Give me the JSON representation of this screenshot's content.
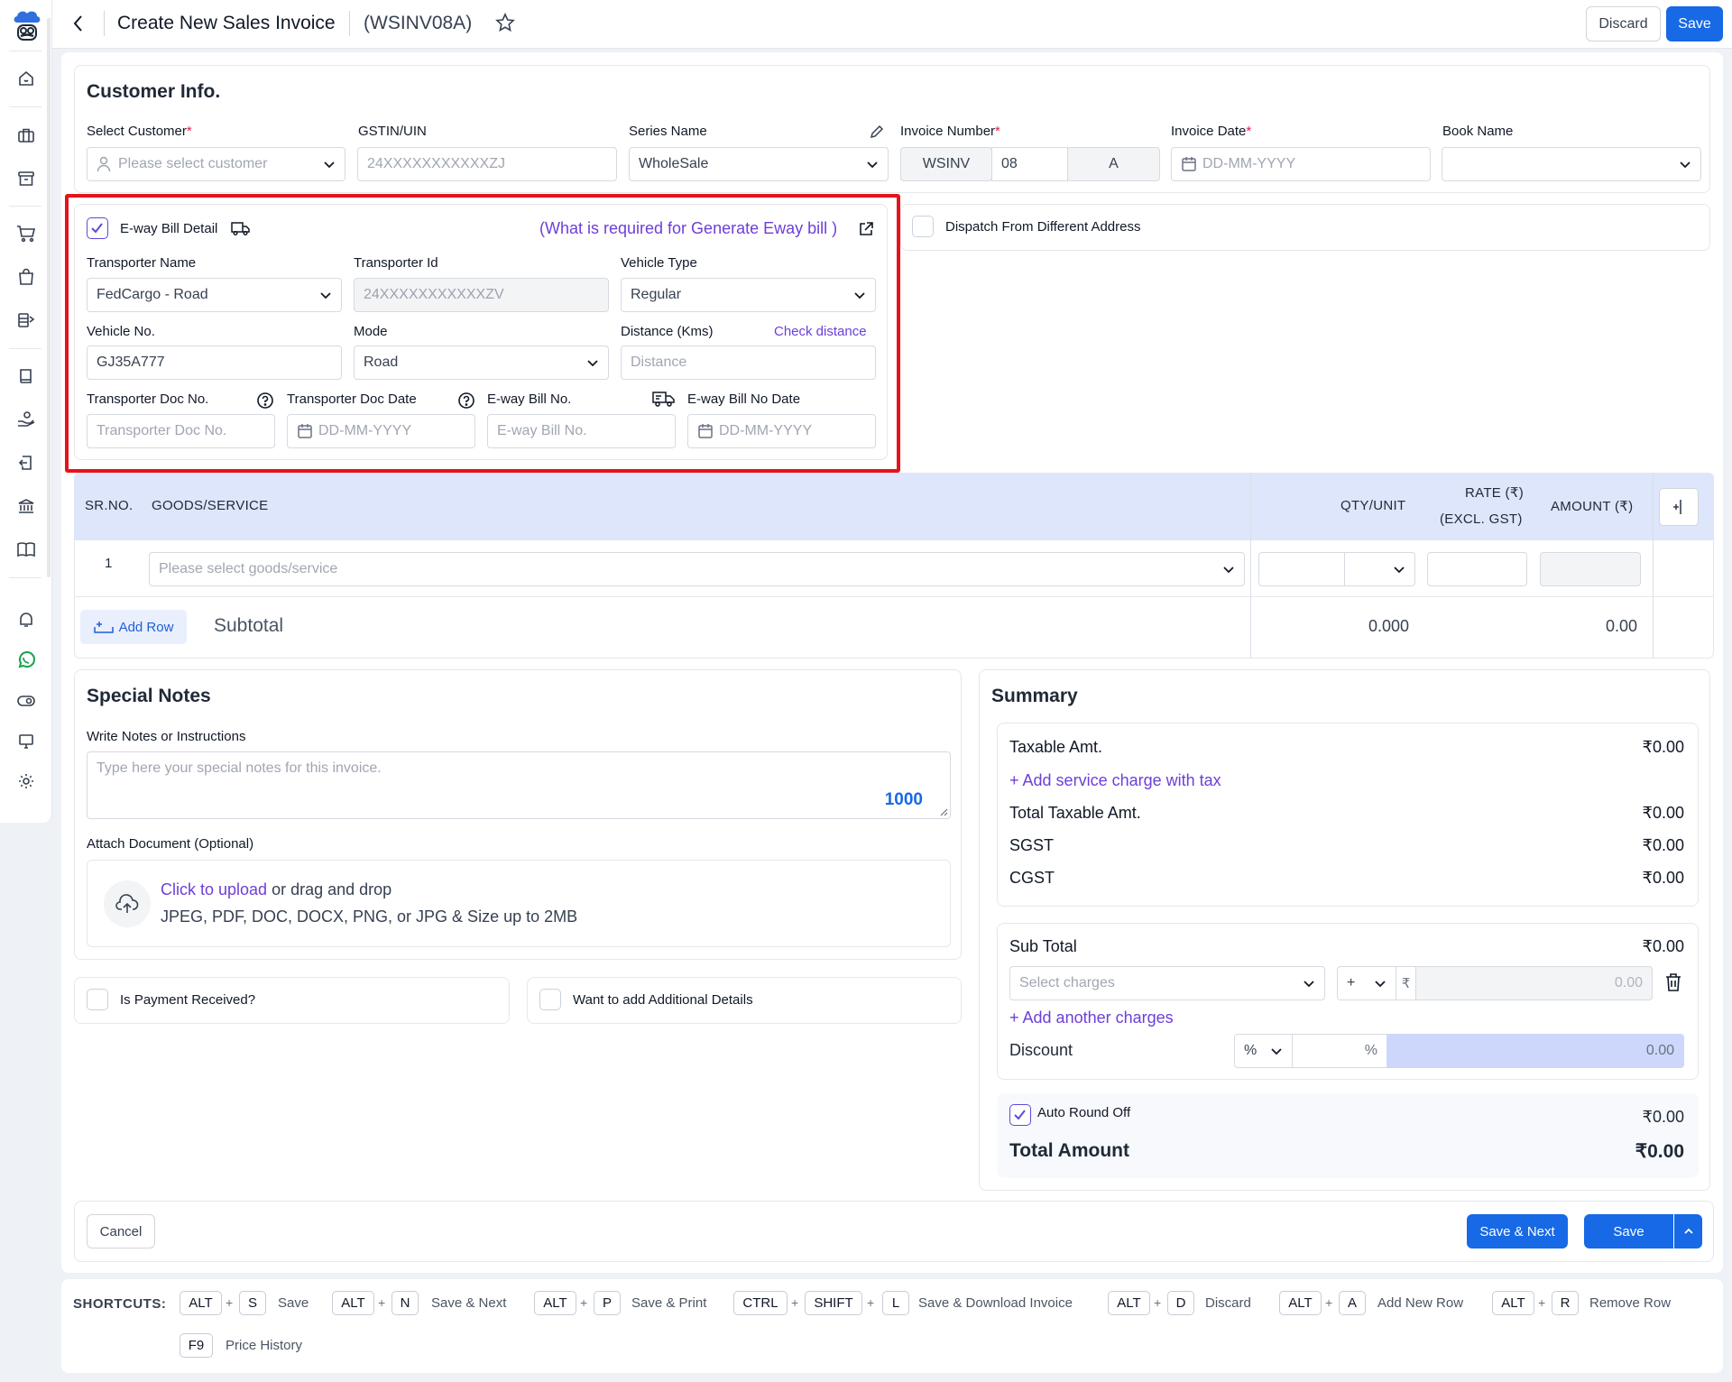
{
  "header": {
    "title": "Create New Sales Invoice",
    "code": "(WSINV08A)",
    "discard_label": "Discard",
    "save_label": "Save"
  },
  "customer_info": {
    "heading": "Customer Info.",
    "select_customer_label": "Select Customer",
    "select_customer_placeholder": "Please select customer",
    "gstin_label": "GSTIN/UIN",
    "gstin_placeholder": "24XXXXXXXXXXXZJ",
    "series_label": "Series Name",
    "series_value": "WholeSale",
    "invoice_number_label": "Invoice Number",
    "invoice_prefix": "WSINV",
    "invoice_number": "08",
    "invoice_suffix": "A",
    "invoice_date_label": "Invoice Date",
    "invoice_date_placeholder": "DD-MM-YYYY",
    "book_name_label": "Book Name",
    "book_name_value": "",
    "required_mark": "*"
  },
  "eway": {
    "checkbox_label": "E-way Bill Detail",
    "checked": true,
    "help_link": "(What is required for Generate Eway bill )",
    "transporter_name_label": "Transporter Name",
    "transporter_name_value": "FedCargo - Road",
    "transporter_id_label": "Transporter Id",
    "transporter_id_placeholder": "24XXXXXXXXXXXZV",
    "vehicle_type_label": "Vehicle Type",
    "vehicle_type_value": "Regular",
    "vehicle_no_label": "Vehicle No.",
    "vehicle_no_value": "GJ35A777",
    "mode_label": "Mode",
    "mode_value": "Road",
    "distance_label": "Distance (Kms)",
    "check_distance": "Check distance",
    "distance_placeholder": "Distance",
    "doc_no_label": "Transporter Doc No.",
    "doc_no_placeholder": "Transporter Doc No.",
    "doc_date_label": "Transporter Doc Date",
    "doc_date_placeholder": "DD-MM-YYYY",
    "eway_no_label": "E-way Bill No.",
    "eway_no_placeholder": "E-way Bill No.",
    "eway_date_label": "E-way Bill No Date",
    "eway_date_placeholder": "DD-MM-YYYY",
    "highlight_color": "#e5131b"
  },
  "dispatch": {
    "label": "Dispatch From Different Address",
    "checked": false
  },
  "items_table": {
    "col_sr": "SR.NO.",
    "col_goods": "GOODS/SERVICE",
    "col_qty": "QTY/UNIT",
    "col_rate_1": "RATE (₹)",
    "col_rate_2": "(EXCL. GST)",
    "col_amount": "AMOUNT (₹)",
    "rows": [
      {
        "sr": "1",
        "goods_placeholder": "Please select goods/service",
        "qty": "",
        "rate": "",
        "amount": ""
      }
    ],
    "add_row_label": "Add Row",
    "subtotal_label": "Subtotal",
    "subtotal_qty": "0.000",
    "subtotal_amount": "0.00"
  },
  "notes": {
    "heading": "Special Notes",
    "write_label": "Write Notes or Instructions",
    "placeholder": "Type here your special notes for this invoice.",
    "char_count": "1000",
    "attach_label": "Attach Document (Optional)",
    "upload_link": "Click to upload",
    "upload_text": "or drag and drop",
    "upload_hint": "JPEG, PDF, DOC, DOCX, PNG, or JPG & Size up to 2MB"
  },
  "payment": {
    "label": "Is Payment Received?",
    "checked": false
  },
  "additional": {
    "label": "Want to add Additional Details",
    "checked": false
  },
  "summary": {
    "heading": "Summary",
    "taxable_label": "Taxable Amt.",
    "taxable_value": "₹0.00",
    "add_service_label": "Add service charge with tax",
    "total_taxable_label": "Total Taxable Amt.",
    "total_taxable_value": "₹0.00",
    "sgst_label": "SGST",
    "sgst_value": "₹0.00",
    "cgst_label": "CGST",
    "cgst_value": "₹0.00",
    "subtotal_label": "Sub Total",
    "subtotal_value": "₹0.00",
    "select_charges_placeholder": "Select charges",
    "charge_sign": "+",
    "rupee_symbol": "₹",
    "charge_amount": "0.00",
    "add_charges_label": "Add another charges",
    "discount_label": "Discount",
    "discount_type": "%",
    "discount_percent_symbol": "%",
    "discount_amount": "0.00",
    "round_off_label": "Auto Round Off",
    "round_off_checked": true,
    "round_off_value": "₹0.00",
    "total_label": "Total Amount",
    "total_value": "₹0.00"
  },
  "footer": {
    "cancel_label": "Cancel",
    "save_next_label": "Save & Next",
    "save_label": "Save"
  },
  "shortcuts": {
    "title": "SHORTCUTS:",
    "items": [
      {
        "keys": [
          "ALT",
          "S"
        ],
        "label": "Save"
      },
      {
        "keys": [
          "ALT",
          "N"
        ],
        "label": "Save & Next"
      },
      {
        "keys": [
          "ALT",
          "P"
        ],
        "label": "Save & Print"
      },
      {
        "keys": [
          "CTRL",
          "SHIFT",
          "L"
        ],
        "label": "Save & Download Invoice"
      },
      {
        "keys": [
          "ALT",
          "D"
        ],
        "label": "Discard"
      },
      {
        "keys": [
          "ALT",
          "A"
        ],
        "label": "Add New Row"
      },
      {
        "keys": [
          "ALT",
          "R"
        ],
        "label": "Remove Row"
      },
      {
        "keys": [
          "F9"
        ],
        "label": "Price History"
      }
    ]
  },
  "colors": {
    "primary": "#1769e6",
    "link": "#6d3fd8",
    "table_header": "#dde6fb",
    "discount_fill": "#cdd7fb"
  }
}
